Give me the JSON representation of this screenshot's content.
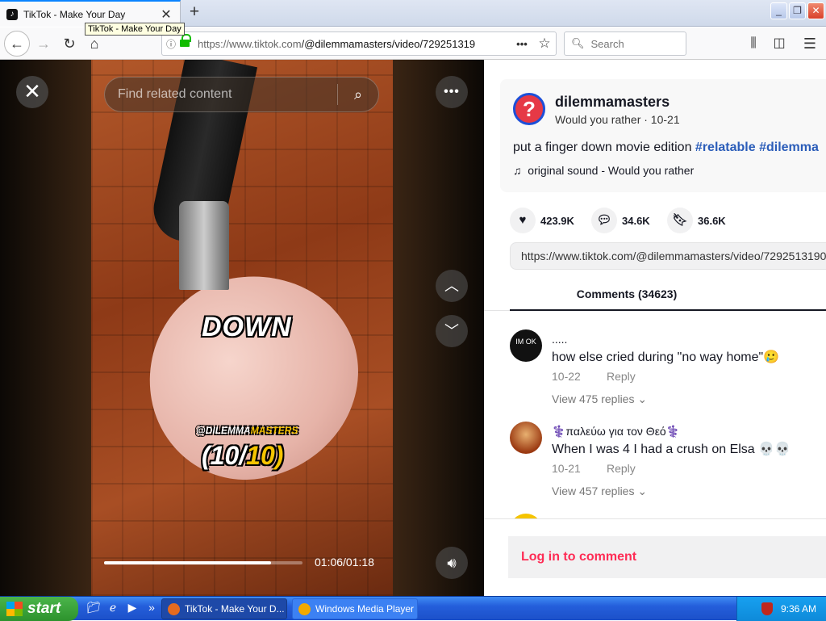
{
  "browser": {
    "tab_title": "TikTok - Make Your Day",
    "tooltip": "TikTok - Make Your Day",
    "url_host": "https://www.tiktok.com",
    "url_path": "/@dilemmamasters/video/729251319",
    "search_placeholder": "Search"
  },
  "video": {
    "overlay_word": "DOWN",
    "watermark_a": "@DILEMMA",
    "watermark_b": "MASTERS",
    "counter_a": "(10/",
    "counter_b": "10)",
    "find_placeholder": "Find related content",
    "time": "01:06/01:18",
    "progress": 0.84
  },
  "post": {
    "username": "dilemmamasters",
    "nickname_date": "Would you rather · 10-21",
    "desc_text": "put a finger down movie edition ",
    "tag1": "#relatable",
    "tag2": "#dilemma",
    "music": "original sound - Would you rather",
    "likes": "423.9K",
    "comments": "34.6K",
    "saves": "36.6K",
    "share_url": "https://www.tiktok.com/@dilemmamasters/video/7292513190",
    "comments_tab": "Comments (34623)"
  },
  "comments": [
    {
      "avatar": "IM OK",
      "user": ".....",
      "text": "how else cried during \"no way home\"🥲",
      "date": "10-22",
      "reply": "Reply",
      "view": "View 475 replies"
    },
    {
      "avatar": "",
      "user": "⚕️παλεύω για τον Θεό⚕️",
      "text": "When I was 4 I had a crush on Elsa 💀💀",
      "date": "10-21",
      "reply": "Reply",
      "view": "View 457 replies"
    }
  ],
  "login_label": "Log in to comment",
  "taskbar": {
    "start": "start",
    "task1": "TikTok - Make Your D...",
    "task2": "Windows Media Player",
    "clock": "9:36 AM"
  },
  "colors": {
    "accent": "#fe2c55",
    "hashtag": "#2b5db9",
    "tab_highlight": "#0a84ff"
  }
}
